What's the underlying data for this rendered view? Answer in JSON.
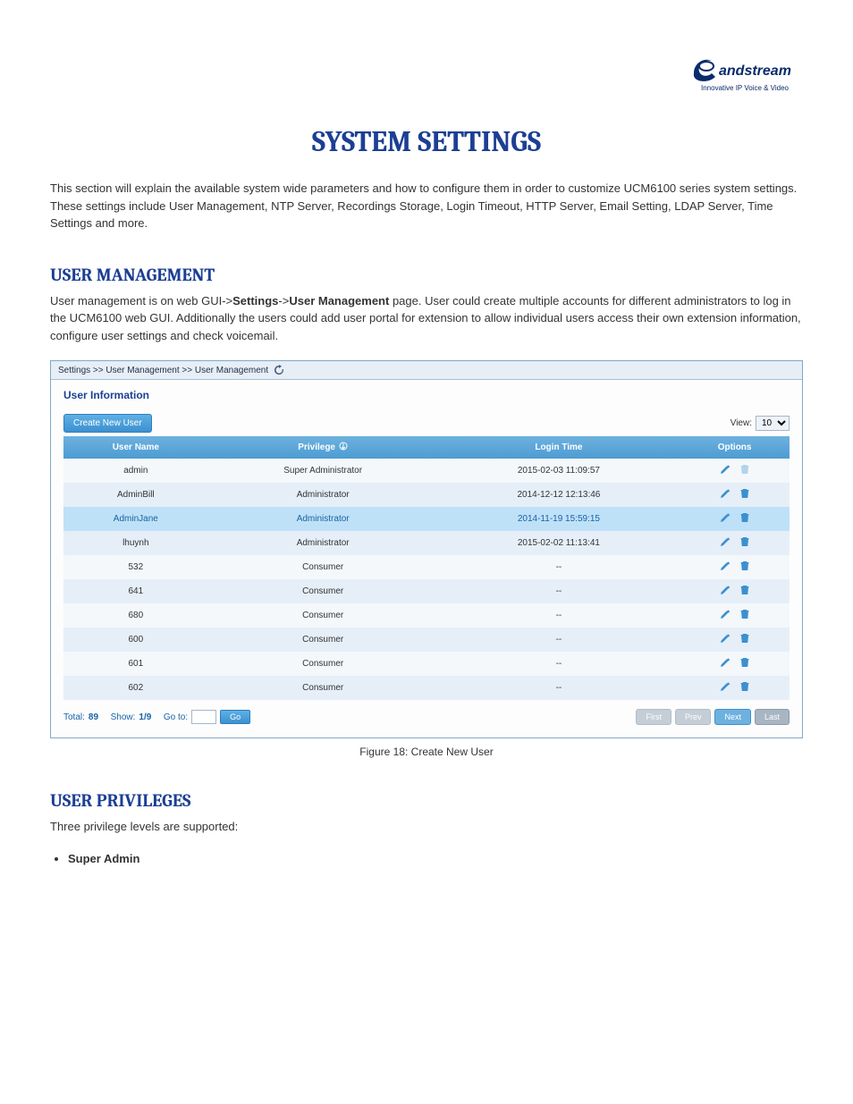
{
  "logo": {
    "brand": "Grandstream",
    "tagline": "Innovative IP Voice & Video"
  },
  "page_title": "SYSTEM SETTINGS",
  "intro": "This section will explain the available system wide parameters and how to configure them in order to customize UCM6100 series system settings. These settings include User Management, NTP Server, Recordings Storage, Login Timeout, HTTP Server, Email Setting, LDAP Server, Time Settings and more.",
  "sections": {
    "user_mgmt": {
      "heading": "USER MANAGEMENT",
      "text_a": "User management is on web GUI->",
      "path1": "Settings",
      "path2": "User Management",
      "text_b": " page. User could create multiple accounts for different administrators to log in the UCM6100 web GUI. Additionally the users could add user portal for extension to allow individual users access their own extension information, configure user settings and check voicemail.",
      "fig_caption": "Figure 18: Create New User"
    },
    "user_priv": {
      "heading": "USER PRIVILEGES",
      "text": "Three privilege levels are supported:",
      "bullets": [
        {
          "title": "Super Admin"
        }
      ]
    }
  },
  "figure": {
    "breadcrumb": "Settings >> User Management >> User Management",
    "panel_title": "User Information",
    "buttons": {
      "create": "Create New User",
      "go": "Go"
    },
    "view_label": "View:",
    "view_value": "10",
    "columns": {
      "user": "User Name",
      "priv": "Privilege",
      "login": "Login Time",
      "opts": "Options"
    },
    "rows": [
      {
        "user": "admin",
        "priv": "Super Administrator",
        "login": "2015-02-03 11:09:57",
        "edit": true,
        "del": false,
        "hi": false
      },
      {
        "user": "AdminBill",
        "priv": "Administrator",
        "login": "2014-12-12 12:13:46",
        "edit": true,
        "del": true,
        "hi": false
      },
      {
        "user": "AdminJane",
        "priv": "Administrator",
        "login": "2014-11-19 15:59:15",
        "edit": true,
        "del": true,
        "hi": true
      },
      {
        "user": "lhuynh",
        "priv": "Administrator",
        "login": "2015-02-02 11:13:41",
        "edit": true,
        "del": true,
        "hi": false
      },
      {
        "user": "532",
        "priv": "Consumer",
        "login": "--",
        "edit": true,
        "del": true,
        "hi": false
      },
      {
        "user": "641",
        "priv": "Consumer",
        "login": "--",
        "edit": true,
        "del": true,
        "hi": false
      },
      {
        "user": "680",
        "priv": "Consumer",
        "login": "--",
        "edit": true,
        "del": true,
        "hi": false
      },
      {
        "user": "600",
        "priv": "Consumer",
        "login": "--",
        "edit": true,
        "del": true,
        "hi": false
      },
      {
        "user": "601",
        "priv": "Consumer",
        "login": "--",
        "edit": true,
        "del": true,
        "hi": false
      },
      {
        "user": "602",
        "priv": "Consumer",
        "login": "--",
        "edit": true,
        "del": true,
        "hi": false
      }
    ],
    "footer": {
      "total_label": "Total:",
      "total": "89",
      "show_label": "Show:",
      "show": "1/9",
      "goto_label": "Go to:"
    },
    "pager": {
      "first": "First",
      "prev": "Prev",
      "next": "Next",
      "last": "Last"
    }
  }
}
